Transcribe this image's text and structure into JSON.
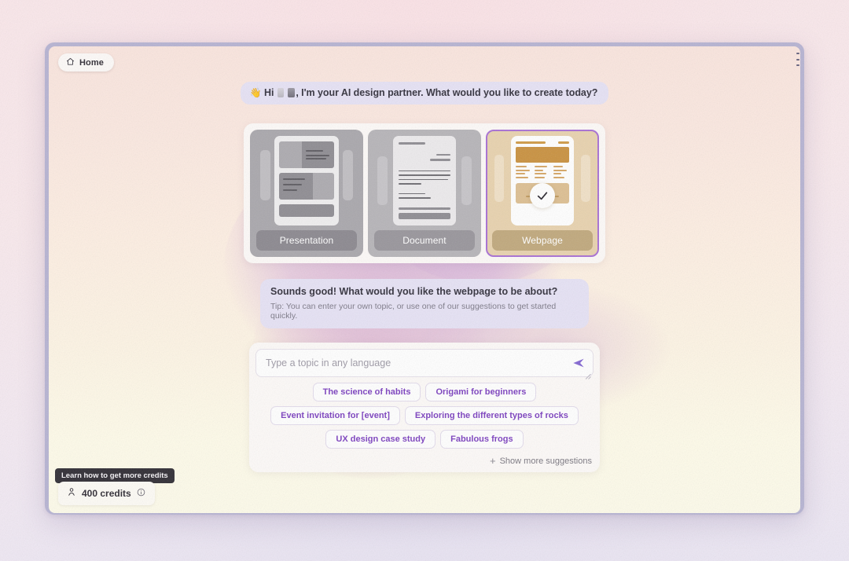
{
  "nav": {
    "home_label": "Home",
    "home_icon": "home-icon"
  },
  "chat": {
    "greeting_prefix": "Hi",
    "greeting_suffix": ", I'm your AI design partner. What would you like to create today?",
    "greeting_emoji": "👋",
    "reply_question": "Sounds good! What would you like the webpage to be about?",
    "reply_tip": "Tip: You can enter your own topic, or use one of our suggestions to get started quickly."
  },
  "type_cards": {
    "selected": "Webpage",
    "selected_border_color": "#a86fd4",
    "items": [
      {
        "label": "Presentation",
        "selected": false
      },
      {
        "label": "Document",
        "selected": false
      },
      {
        "label": "Webpage",
        "selected": true
      }
    ]
  },
  "composer": {
    "input_value": "",
    "input_placeholder": "Type a topic in any language",
    "send_icon": "send-icon",
    "accent_color": "#7b3fbf",
    "suggestions": [
      "The science of habits",
      "Origami for beginners",
      "Event invitation for [event]",
      "Exploring the different types of rocks",
      "UX design case study",
      "Fabulous frogs"
    ],
    "show_more_label": "Show more suggestions",
    "show_more_icon": "plus-icon"
  },
  "credits": {
    "tooltip": "Learn how to get more credits",
    "amount_label": "400 credits",
    "person_icon": "person-icon",
    "info_icon": "info-icon"
  }
}
